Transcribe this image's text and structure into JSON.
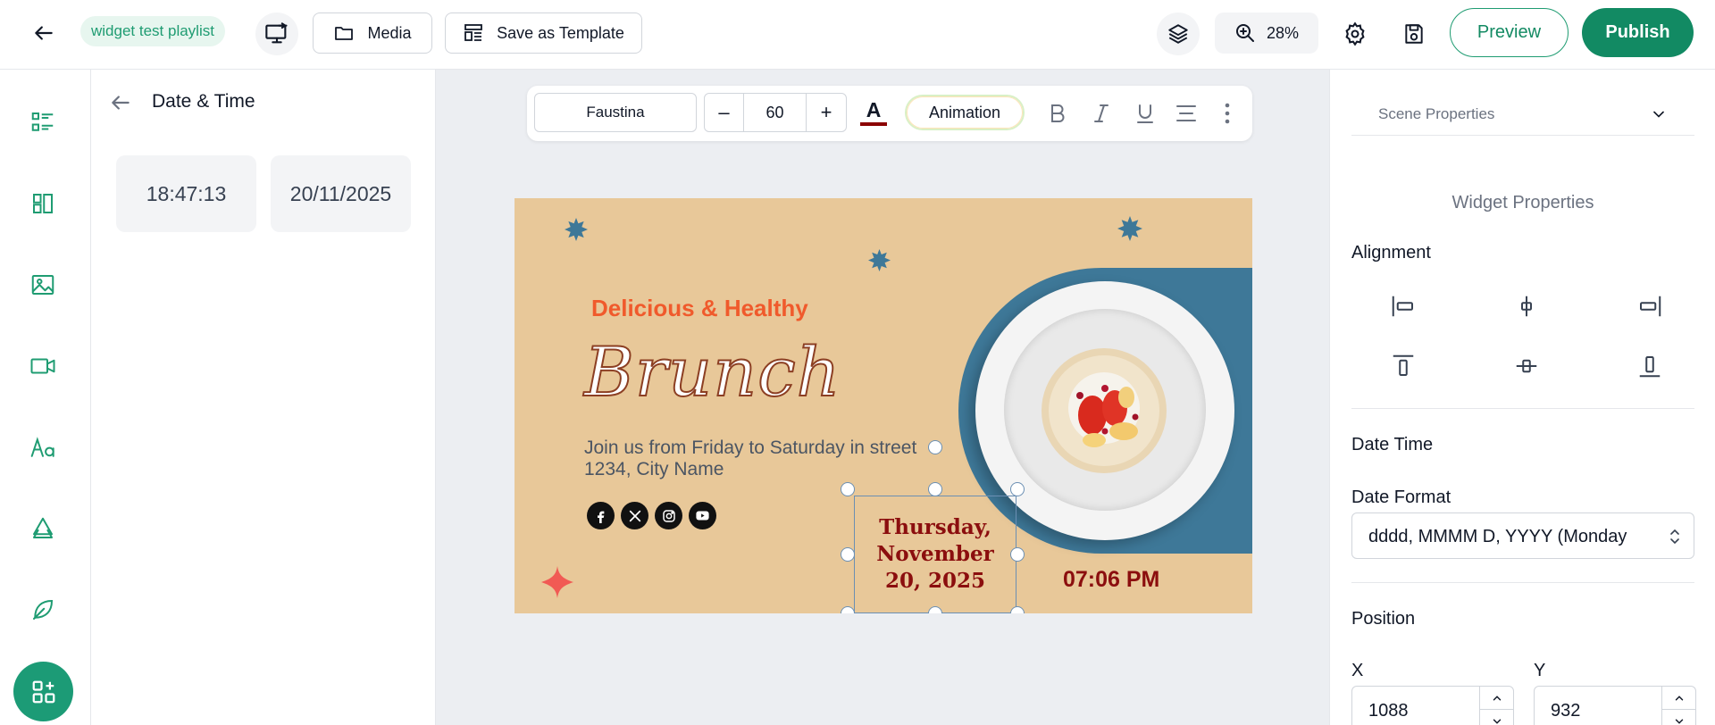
{
  "topbar": {
    "playlist_name": "widget test playlist",
    "media_label": "Media",
    "save_template_label": "Save as Template",
    "zoom_level": "28%",
    "preview_label": "Preview",
    "publish_label": "Publish"
  },
  "rail": {
    "items": [
      "list-icon",
      "layout-icon",
      "image-icon",
      "video-icon",
      "text-icon",
      "shapes-icon",
      "leaf-icon"
    ],
    "fab": "apps-add-icon"
  },
  "panel": {
    "title": "Date & Time",
    "time_chip": "18:47:13",
    "date_chip": "20/11/2025"
  },
  "text_toolbar": {
    "font": "Faustina",
    "font_size": "60",
    "minus": "–",
    "plus": "+",
    "text_color_glyph": "A",
    "text_color": "#8b0000",
    "animation_label": "Animation"
  },
  "design": {
    "heading": "Delicious & Healthy",
    "title": "Brunch",
    "invite_line1": "Join us from Friday to Saturday in street",
    "invite_line2": "1234, City Name",
    "date_widget_text": "Thursday, November 20, 2025",
    "clock_text": "07:06 PM",
    "socials": [
      "facebook-icon",
      "x-icon",
      "instagram-icon",
      "youtube-icon"
    ],
    "colors": {
      "background": "#e8c899",
      "accent_orange": "#f05a2c",
      "blue_shape": "#3e7898",
      "dark_red": "#8b0e0e"
    }
  },
  "props": {
    "scene_properties": "Scene Properties",
    "widget_properties": "Widget Properties",
    "alignment_title": "Alignment",
    "date_time_title": "Date Time",
    "date_format_label": "Date Format",
    "date_format_value": "dddd, MMMM D, YYYY (Monday",
    "position_title": "Position",
    "x_label": "X",
    "x_value": "1088",
    "y_label": "Y",
    "y_value": "932"
  },
  "colors": {
    "brand_green": "#1f9c72",
    "publish_bg": "#128a63"
  }
}
